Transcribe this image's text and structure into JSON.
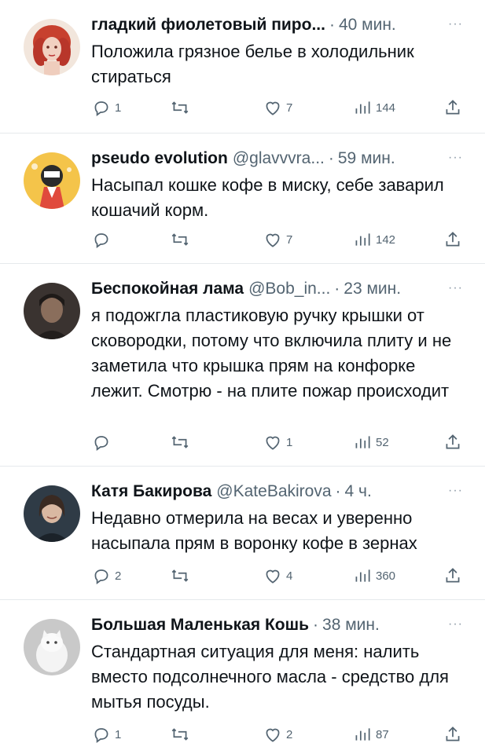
{
  "tweets": [
    {
      "name": "гладкий фиолетовый пиро...",
      "handle": "",
      "time": "40 мин.",
      "text": "Положила грязное белье в холодильник стираться",
      "replies": "1",
      "retweets": "",
      "likes": "7",
      "views": "144"
    },
    {
      "name": "pseudo evolution",
      "handle": "@glavvvra...",
      "time": "59 мин.",
      "text": "Насыпал кошке кофе в миску, себе заварил кошачий корм.",
      "replies": "",
      "retweets": "",
      "likes": "7",
      "views": "142"
    },
    {
      "name": "Беспокойная лама",
      "handle": "@Bob_in...",
      "time": "23 мин.",
      "text": "я подожгла пластиковую ручку крышки от сковородки, потому что включила плиту и не заметила что крышка прям на конфорке лежит. Смотрю - на плите пожар происходит",
      "replies": "",
      "retweets": "",
      "likes": "1",
      "views": "52"
    },
    {
      "name": "Катя Бакирова",
      "handle": "@KateBakirova",
      "time": "4 ч.",
      "text": "Недавно отмерила на весах и уверенно насыпала прям в воронку кофе в зернах",
      "replies": "2",
      "retweets": "",
      "likes": "4",
      "views": "360"
    },
    {
      "name": "Большая Маленькая Кошь",
      "handle": "",
      "time": "38 мин.",
      "text": "Стандартная ситуация для меня: налить вместо подсолнечного масла - средство для мытья посуды.",
      "replies": "1",
      "retweets": "",
      "likes": "2",
      "views": "87"
    }
  ],
  "separator": "·",
  "more_glyph": "···",
  "icons": {
    "reply": "reply-icon",
    "retweet": "retweet-icon",
    "like": "heart-icon",
    "views": "views-icon",
    "share": "share-icon"
  },
  "colors": {
    "text": "#0f1419",
    "secondary": "#536471",
    "divider": "#e6e9ec"
  }
}
